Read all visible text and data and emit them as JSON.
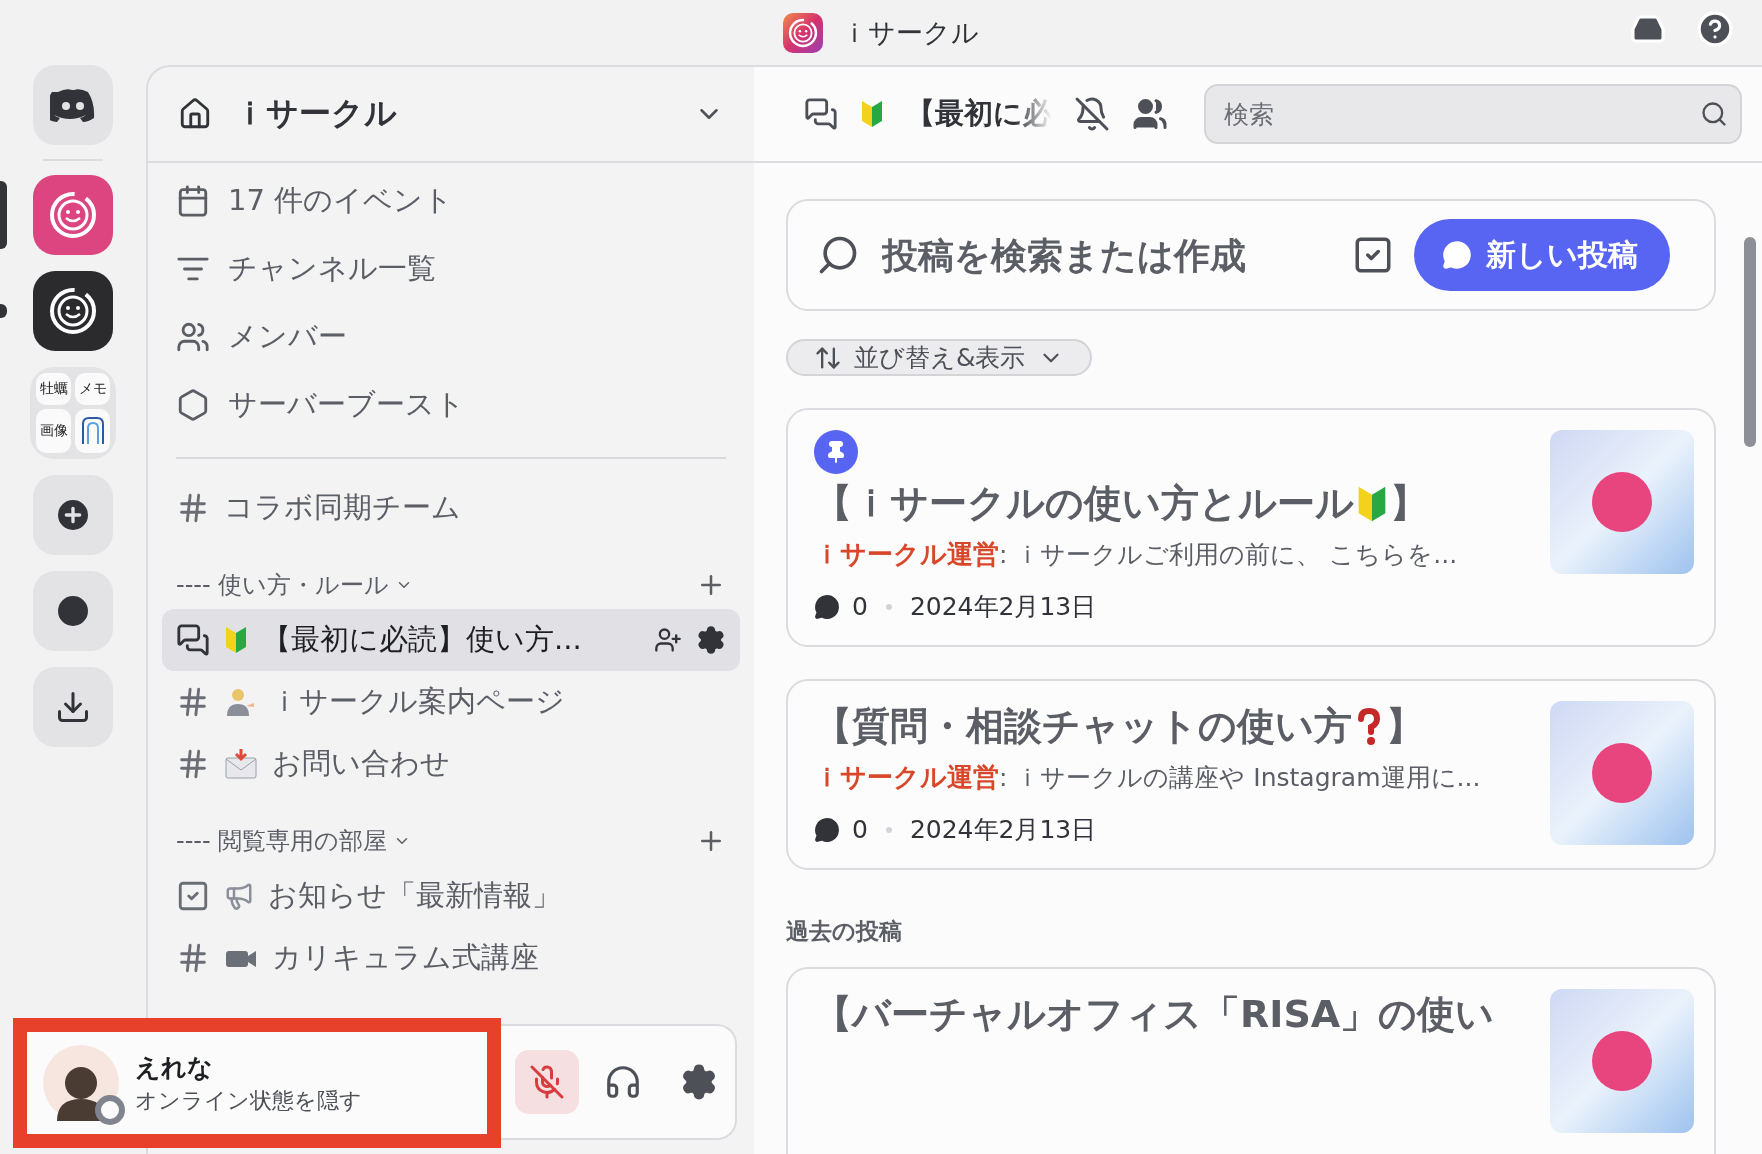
{
  "title_bar": {
    "title": "ｉサークル"
  },
  "servers": [
    {
      "kind": "home"
    },
    {
      "kind": "server",
      "color": "#dc4580",
      "selected": true,
      "unread": false
    },
    {
      "kind": "server",
      "color": "#2b2b2e",
      "selected": false,
      "unread": true
    },
    {
      "kind": "folder",
      "items": [
        "牡蠣",
        "メモ",
        "画像"
      ]
    },
    {
      "kind": "add"
    },
    {
      "kind": "discover"
    },
    {
      "kind": "download"
    }
  ],
  "sidebar": {
    "server_name": "ｉサークル",
    "links": [
      {
        "kind": "events",
        "label": "17 件のイベント"
      },
      {
        "kind": "browse",
        "label": "チャンネル一覧"
      },
      {
        "kind": "members",
        "label": "メンバー"
      },
      {
        "kind": "boost",
        "label": "サーバーブースト"
      }
    ],
    "channels": [
      {
        "kind": "text",
        "name": "コラボ同期チーム",
        "selected": false
      }
    ],
    "categories": [
      {
        "name": "---- 使い方・ルール",
        "channels": [
          {
            "kind": "forum",
            "name": "【最初に必読】使い方...",
            "selected": true
          },
          {
            "kind": "text",
            "name": "ｉサークル案内ページ",
            "selected": false
          },
          {
            "kind": "text",
            "name": "お問い合わせ",
            "selected": false
          }
        ]
      },
      {
        "name": "---- 閲覧専用の部屋",
        "channels": [
          {
            "kind": "announcement",
            "name": "お知らせ「最新情報」",
            "selected": false
          },
          {
            "kind": "text",
            "name": "カリキュラム式講座",
            "selected": false
          }
        ]
      }
    ]
  },
  "main": {
    "channel": "【最初に必",
    "search_placeholder": "検索",
    "composer_placeholder": "投稿を検索または作成",
    "new_post": "新しい投稿",
    "sort": "並び替え&表示",
    "posts": [
      {
        "pinned": true,
        "title": "【ｉサークルの使い方とルール",
        "title_end": "】",
        "author": "ｉサークル運営",
        "snippet": ": ｉサークルご利用の前に、 こちらを...",
        "comments": "0",
        "date": "2024年2月13日"
      },
      {
        "pinned": false,
        "title": "【質問・相談チャットの使い方",
        "title_end": "】",
        "author": "ｉサークル運営",
        "snippet": ": ｉサークルの講座や Instagram運用に...",
        "comments": "0",
        "date": "2024年2月13日"
      }
    ],
    "past_label": "過去の投稿",
    "past_posts": [
      {
        "title": "【バーチャルオフィス「RISA」の使い"
      }
    ]
  },
  "user_panel": {
    "name": "えれな",
    "status": "オンライン状態を隠す",
    "muted": true,
    "highlighted": true
  }
}
